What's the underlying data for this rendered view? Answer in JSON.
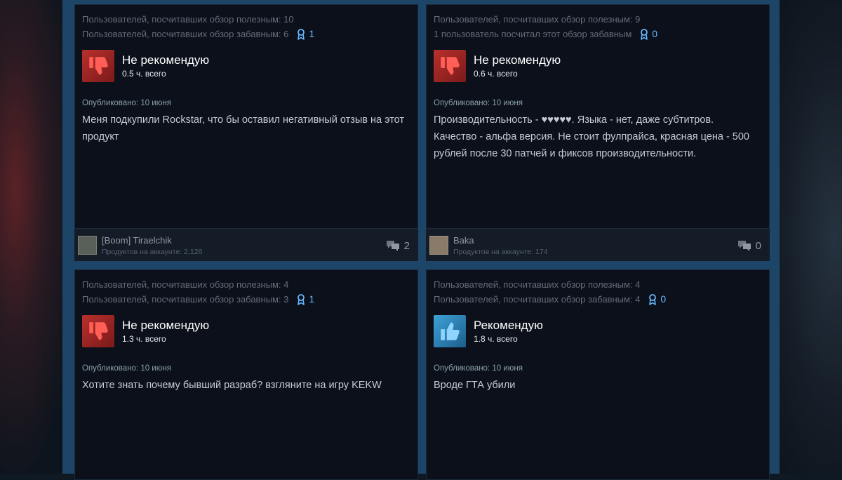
{
  "reviews": [
    {
      "helpful": "Пользователей, посчитавших обзор полезным: 10",
      "funny": "Пользователей, посчитавших обзор забавным: 6",
      "awards": "1",
      "verdict": "Не рекомендую",
      "recommended": false,
      "hours": "0.5 ч. всего",
      "posted": "Опубликовано: 10 июня",
      "text": "Меня подкупили Rockstar, что бы оставил негативный отзыв на этот продукт",
      "author": "[Boom] Tiraelchik",
      "products": "Продуктов на аккаунте: 2,126",
      "comments": "2"
    },
    {
      "helpful": "Пользователей, посчитавших обзор полезным: 9",
      "funny": "1 пользователь посчитал этот обзор забавным",
      "awards": "0",
      "verdict": "Не рекомендую",
      "recommended": false,
      "hours": "0.6 ч. всего",
      "posted": "Опубликовано: 10 июня",
      "text": "Производительность - ♥♥♥♥♥. Языка - нет, даже субтитров. Качество - альфа версия. Не стоит фулпрайса, красная цена - 500 рублей после 30 патчей и фиксов производительности.",
      "author": "Baka",
      "products": "Продуктов на аккаунте: 174",
      "comments": "0"
    },
    {
      "helpful": "Пользователей, посчитавших обзор полезным: 4",
      "funny": "Пользователей, посчитавших обзор забавным: 3",
      "awards": "1",
      "verdict": "Не рекомендую",
      "recommended": false,
      "hours": "1.3 ч. всего",
      "posted": "Опубликовано: 10 июня",
      "text": "Хотите знать почему бывший разраб? взгляните на игру KEKW"
    },
    {
      "helpful": "Пользователей, посчитавших обзор полезным: 4",
      "funny": "Пользователей, посчитавших обзор забавным: 4",
      "awards": "0",
      "verdict": "Рекомендую",
      "recommended": true,
      "hours": "1.8 ч. всего",
      "posted": "Опубликовано: 10 июня",
      "text": "Вроде ГТА убили"
    }
  ],
  "colors": {
    "not_recommended": "#b8302c",
    "recommended": "#3da3d6",
    "award": "#67b7ff",
    "card_bg": "#0b101a"
  },
  "icons": {
    "thumbs_down": "thumbs-down-icon",
    "thumbs_up": "thumbs-up-icon",
    "award": "award-icon",
    "comments": "comments-icon"
  }
}
